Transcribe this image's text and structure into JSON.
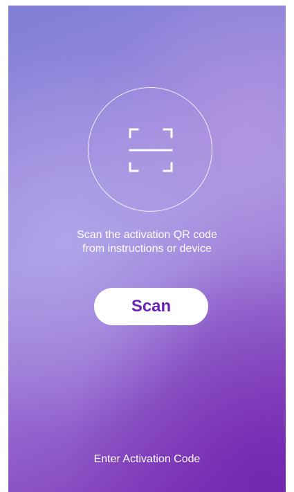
{
  "scan": {
    "icon": "qr-scan-icon",
    "instructions_line1": "Scan the activation QR code",
    "instructions_line2": "from instructions or device",
    "button_label": "Scan"
  },
  "footer": {
    "enter_code_label": "Enter Activation Code"
  },
  "colors": {
    "button_text": "#6a22b5",
    "gradient_start": "#7f7fd6",
    "gradient_end": "#7b34b6"
  }
}
